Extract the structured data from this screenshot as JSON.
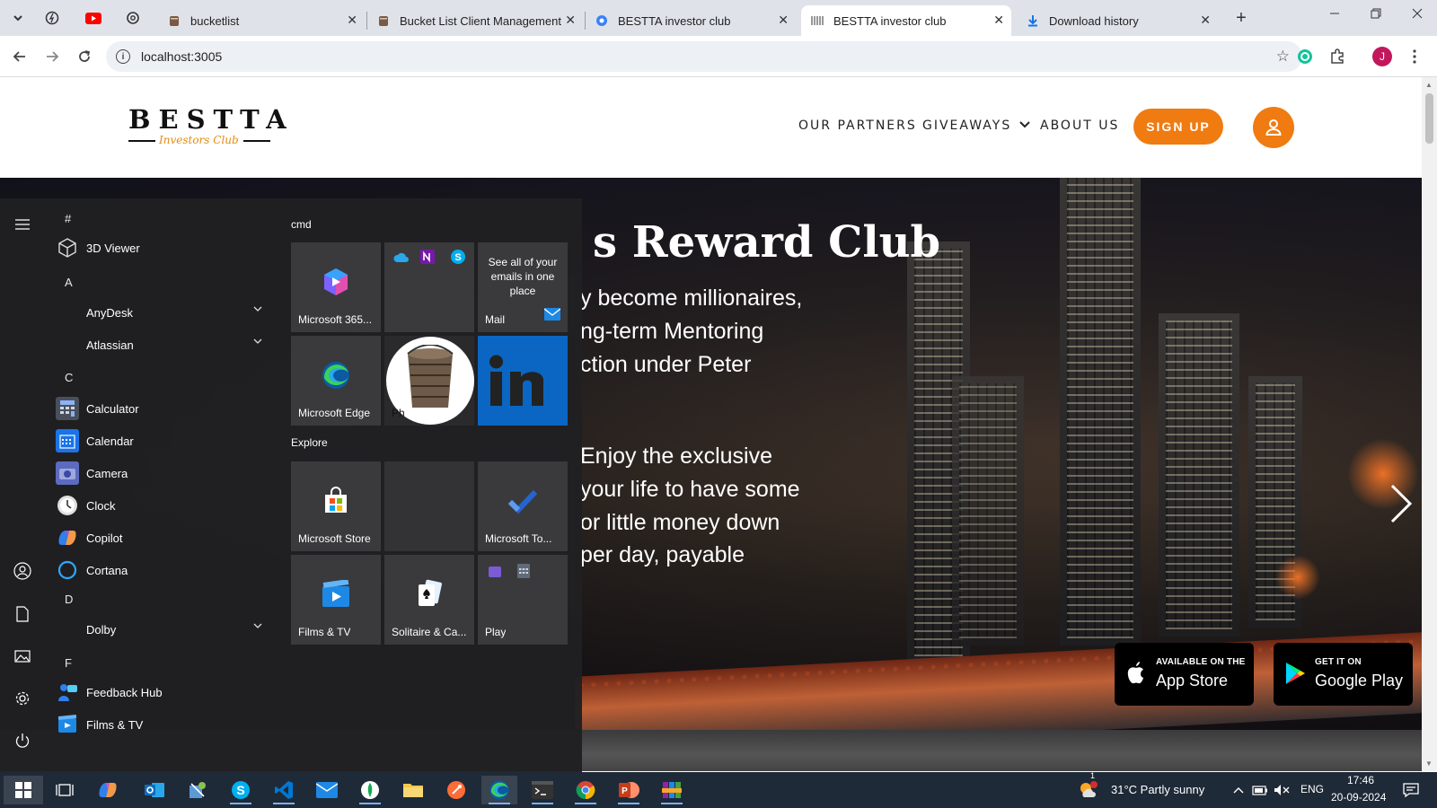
{
  "browser": {
    "tabs": [
      {
        "title": "bucketlist",
        "active": false
      },
      {
        "title": "Bucket List Client Management",
        "active": false
      },
      {
        "title": "BESTTA investor club",
        "active": false
      },
      {
        "title": "BESTTA investor club",
        "active": true
      },
      {
        "title": "Download history",
        "active": false
      }
    ],
    "url": "localhost:3005",
    "profile_initial": "J"
  },
  "site": {
    "logo_word": "BESTTA",
    "logo_script": "Investors Club",
    "nav": {
      "partners": "OUR PARTNERS",
      "giveaways": "GIVEAWAYS",
      "about": "ABOUT US",
      "signup": "SIGN UP"
    },
    "hero": {
      "title": "s Reward Club",
      "lines": [
        "y become millionaires,",
        "ng-term Mentoring",
        "ction under Peter",
        "Enjoy the exclusive",
        "your life to have some",
        "or little money down",
        " per day, payable"
      ]
    },
    "stores": {
      "apple_small": "AVAILABLE ON THE",
      "apple_big": "App Store",
      "google_small": "GET IT ON",
      "google_big": "Google Play"
    }
  },
  "start_menu": {
    "letters": {
      "hash": "#",
      "a": "A",
      "c": "C",
      "d": "D",
      "f": "F"
    },
    "apps": {
      "viewer": "3D Viewer",
      "anydesk": "AnyDesk",
      "atlassian": "Atlassian",
      "calculator": "Calculator",
      "calendar": "Calendar",
      "camera": "Camera",
      "clock": "Clock",
      "copilot": "Copilot",
      "cortana": "Cortana",
      "dolby": "Dolby",
      "feedback": "Feedback Hub",
      "films": "Films & TV"
    },
    "groups": {
      "cmd": "cmd",
      "explore": "Explore"
    },
    "tiles": {
      "m365": "Microsoft 365...",
      "mail_desc": "See all of your emails in one place",
      "mail": "Mail",
      "edge": "Microsoft Edge",
      "bucket": "Ph",
      "store": "Microsoft Store",
      "todo": "Microsoft To...",
      "films": "Films & TV",
      "solitaire": "Solitaire & Ca...",
      "play": "Play"
    }
  },
  "taskbar": {
    "weather": "31°C  Partly sunny",
    "lang": "ENG",
    "time": "17:46",
    "date": "20-09-2024",
    "weather_badge": "1"
  },
  "colors": {
    "accent": "#f07b10",
    "taskbar": "#1f2a38",
    "start_bg": "#202022"
  }
}
